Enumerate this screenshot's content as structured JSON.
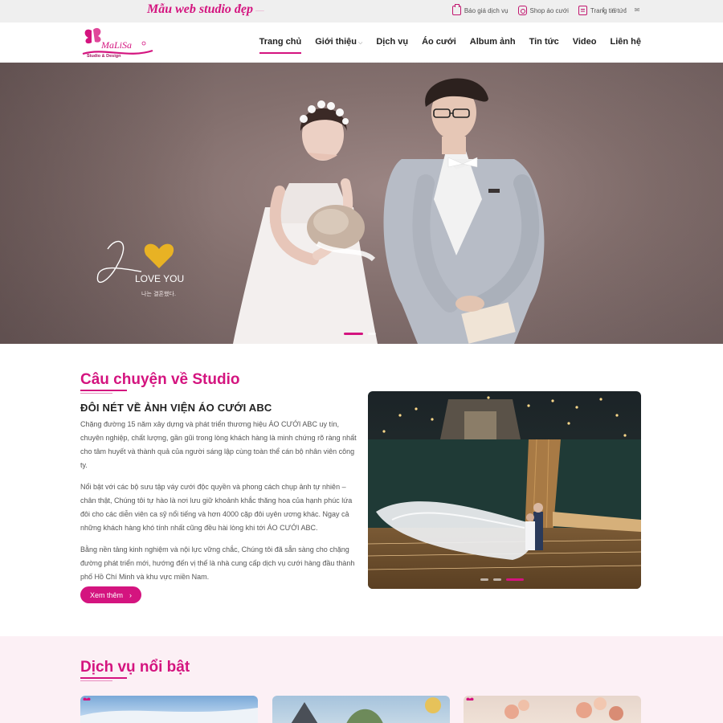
{
  "topbar": {
    "brand_tag": "Mẫu web studio đẹp",
    "links": [
      {
        "label": "Báo giá dịch vụ",
        "icon": "quote-icon"
      },
      {
        "label": "Shop áo cưới",
        "icon": "instagram-icon"
      },
      {
        "label": "Trang tin tức",
        "icon": "news-icon"
      }
    ],
    "social": [
      "f",
      "◎",
      "t",
      "✉"
    ]
  },
  "header": {
    "logo_text": "MaLiSa",
    "logo_sub": "Studio & Design",
    "nav": [
      {
        "label": "Trang chủ",
        "active": true
      },
      {
        "label": "Giới thiệu",
        "dropdown": true
      },
      {
        "label": "Dịch vụ"
      },
      {
        "label": "Áo cưới"
      },
      {
        "label": "Album ảnh"
      },
      {
        "label": "Tin tức"
      },
      {
        "label": "Video"
      },
      {
        "label": "Liên hệ"
      }
    ]
  },
  "hero": {
    "love_text": "LOVE YOU",
    "korean_text": "나는 결혼했다.",
    "slide_count": 2,
    "active_slide": 1
  },
  "about": {
    "title": "Câu chuyện về Studio",
    "subtitle": "ĐÔI NÉT VỀ ẢNH VIỆN ÁO CƯỚI ABC",
    "paragraphs": [
      "Chặng đường 15 năm xây dựng và phát triển thương hiệu ÁO CƯỚI ABC uy tín, chuyên nghiệp, chất lượng, gần gũi trong lòng khách hàng là minh chứng rõ ràng nhất cho tâm huyết và thành quả của người sáng lập cùng toàn thể cán bộ nhân viên công ty.",
      "Nổi bật với các bộ sưu tập váy cưới độc quyền và phong cách chụp ảnh tự nhiên – chân thật, Chúng tôi tự hào là nơi lưu giữ khoảnh khắc thăng hoa của hạnh phúc lứa đôi cho các diễn viên ca sỹ nổi tiếng và hơn 4000 cặp đôi uyên ương khác. Ngay cả những khách hàng khó tính nhất cũng đều hài lòng khi tới  ÁO CƯỚI ABC.",
      "Bằng nền tảng kinh nghiệm và nội lực vững chắc, Chúng tôi đã sẵn sàng cho chặng đường phát triển mới, hướng đến vị thế là nhà cung cấp dịch vụ cưới hàng đầu thành phố Hồ Chí Minh và khu vực miền Nam."
    ],
    "button_label": "Xem thêm",
    "button_arrow": "›"
  },
  "services": {
    "title": "Dịch vụ nổi bật"
  },
  "colors": {
    "accent": "#d4147f",
    "services_bg": "#fcf0f5"
  }
}
